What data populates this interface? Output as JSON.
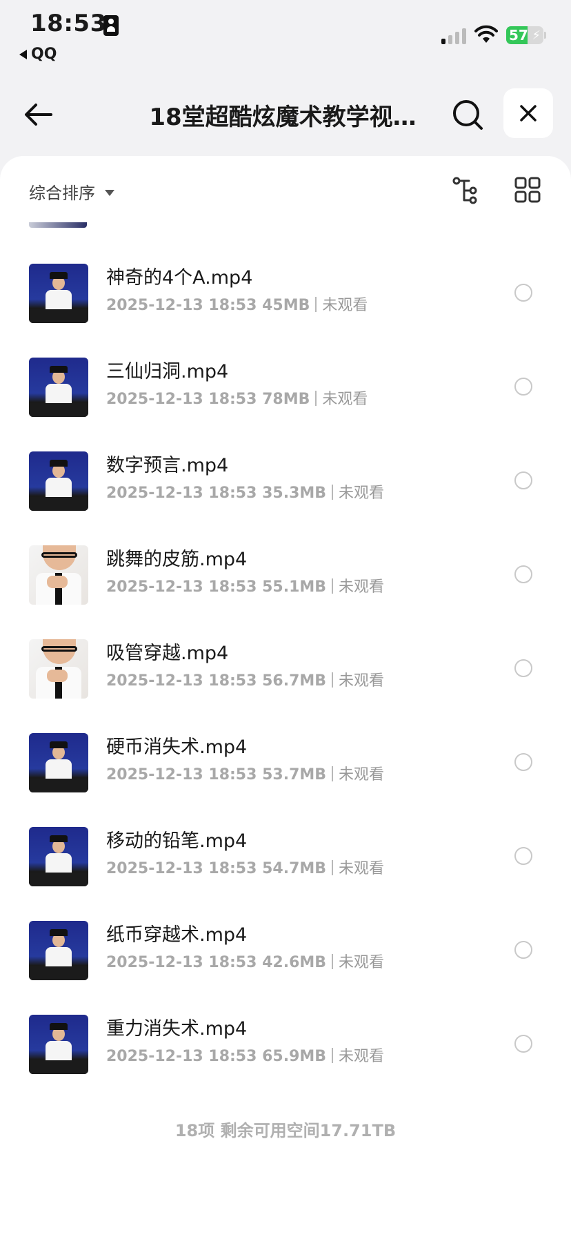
{
  "status_bar": {
    "time": "18:53",
    "back_app": "QQ",
    "battery": "57",
    "battery_level": 0.57
  },
  "nav": {
    "title": "18堂超酷炫魔术教学视…"
  },
  "toolbar": {
    "sort_label": "综合排序"
  },
  "files": [
    {
      "name": "神奇的4个A.mp4",
      "date": "2025-12-13 18:53",
      "size": "45MB",
      "status": "未观看",
      "thumb": "blue"
    },
    {
      "name": "三仙归洞.mp4",
      "date": "2025-12-13 18:53",
      "size": "78MB",
      "status": "未观看",
      "thumb": "blue"
    },
    {
      "name": "数字预言.mp4",
      "date": "2025-12-13 18:53",
      "size": "35.3MB",
      "status": "未观看",
      "thumb": "blue"
    },
    {
      "name": "跳舞的皮筋.mp4",
      "date": "2025-12-13 18:53",
      "size": "55.1MB",
      "status": "未观看",
      "thumb": "white"
    },
    {
      "name": "吸管穿越.mp4",
      "date": "2025-12-13 18:53",
      "size": "56.7MB",
      "status": "未观看",
      "thumb": "white"
    },
    {
      "name": "硬币消失术.mp4",
      "date": "2025-12-13 18:53",
      "size": "53.7MB",
      "status": "未观看",
      "thumb": "blue"
    },
    {
      "name": "移动的铅笔.mp4",
      "date": "2025-12-13 18:53",
      "size": "54.7MB",
      "status": "未观看",
      "thumb": "blue"
    },
    {
      "name": "纸币穿越术.mp4",
      "date": "2025-12-13 18:53",
      "size": "42.6MB",
      "status": "未观看",
      "thumb": "blue"
    },
    {
      "name": "重力消失术.mp4",
      "date": "2025-12-13 18:53",
      "size": "65.9MB",
      "status": "未观看",
      "thumb": "blue"
    }
  ],
  "footer": {
    "summary": "18项 剩余可用空间17.71TB"
  }
}
